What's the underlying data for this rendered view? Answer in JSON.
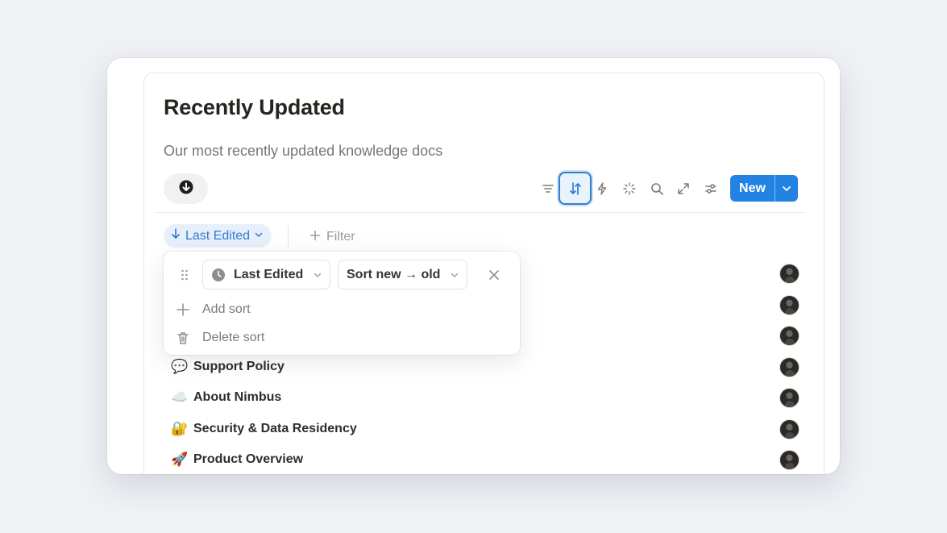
{
  "page": {
    "title": "Recently Updated",
    "subtitle": "Our most recently updated knowledge docs"
  },
  "toolbar": {
    "view_icon": "arrow-down-circle-icon",
    "icons": [
      "filter-icon",
      "sort-icon",
      "automation-bolt-icon",
      "ai-sparkle-icon",
      "search-icon",
      "expand-icon",
      "settings-sliders-icon"
    ],
    "new_label": "New",
    "active": "sort-icon"
  },
  "sort_chip": {
    "label": "Last Edited"
  },
  "filter": {
    "label": "Filter"
  },
  "sort_popover": {
    "property": "Last Edited",
    "direction": "Sort new → old",
    "add_label": "Add sort",
    "delete_label": "Delete sort"
  },
  "rows": [
    {
      "emoji": "💬",
      "title": "Support Policy"
    },
    {
      "emoji": "☁️",
      "title": "About Nimbus"
    },
    {
      "emoji": "🔐",
      "title": "Security & Data Residency"
    },
    {
      "emoji": "🚀",
      "title": "Product Overview"
    }
  ],
  "colors": {
    "accent": "#2383e2",
    "chip_bg": "#e7f0fa",
    "chip_text": "#2e7ad1",
    "page_bg": "#eff1f5"
  }
}
